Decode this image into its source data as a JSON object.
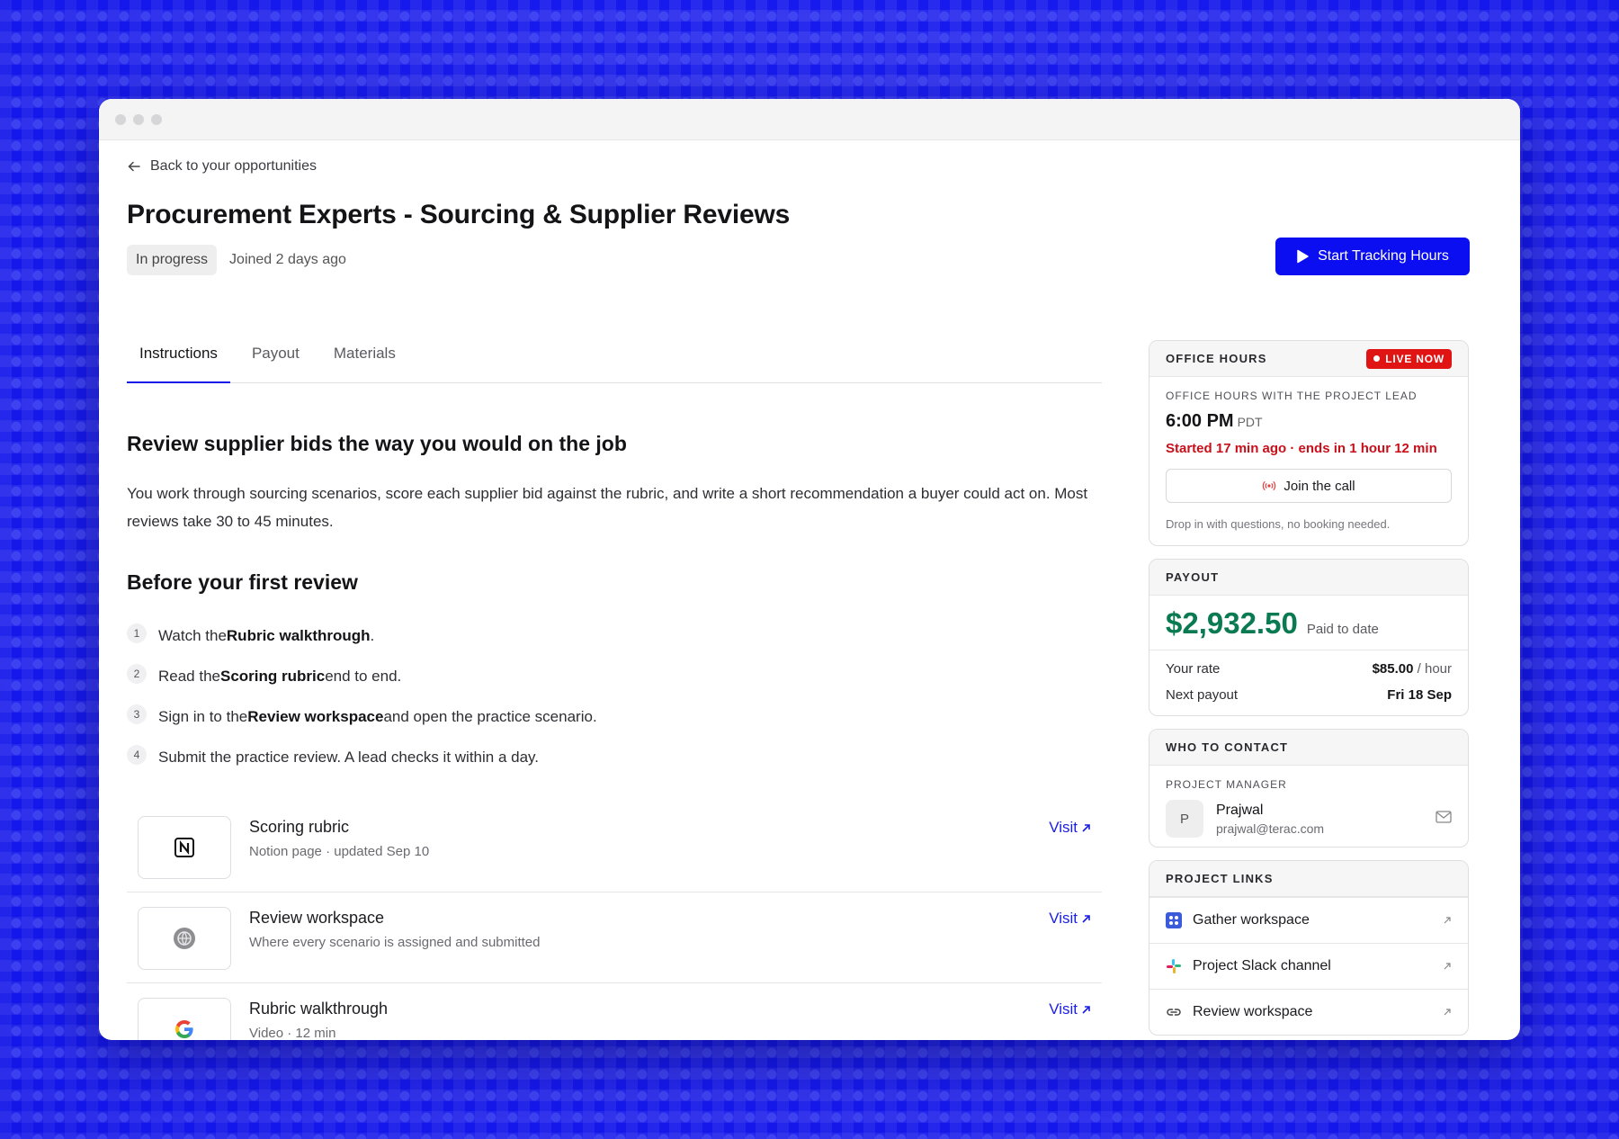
{
  "window": {
    "title": ""
  },
  "nav": {
    "back_label": "Back to your opportunities"
  },
  "header": {
    "title": "Procurement Experts - Sourcing & Supplier Reviews",
    "status": "In progress",
    "joined": "Joined 2 days ago",
    "cta_label": "Start Tracking Hours"
  },
  "tabs": [
    {
      "label": "Instructions",
      "active": true
    },
    {
      "label": "Payout",
      "active": false
    },
    {
      "label": "Materials",
      "active": false
    }
  ],
  "instructions": {
    "heading": "Review supplier bids the way you would on the job",
    "body": "You work through sourcing scenarios, score each supplier bid against the rubric, and write a short recommendation a buyer could act on. Most reviews take 30 to 45 minutes.",
    "steps_heading": "Before your first review",
    "steps": [
      {
        "num": "1",
        "pre": "Watch the ",
        "bold": "Rubric walkthrough",
        "post": "."
      },
      {
        "num": "2",
        "pre": "Read the ",
        "bold": "Scoring rubric",
        "post": " end to end."
      },
      {
        "num": "3",
        "pre": "Sign in to the ",
        "bold": "Review workspace",
        "post": " and open the practice scenario."
      },
      {
        "num": "4",
        "pre": "Submit the practice review. A lead checks it within a day.",
        "bold": "",
        "post": ""
      }
    ]
  },
  "resources": [
    {
      "title": "Scoring rubric",
      "subtitle": "Notion page · updated Sep 10",
      "action": "Visit",
      "icon": "notion-icon"
    },
    {
      "title": "Review workspace",
      "subtitle": "Where every scenario is assigned and submitted",
      "action": "Visit",
      "icon": "globe-icon"
    },
    {
      "title": "Rubric walkthrough",
      "subtitle": "Video · 12 min",
      "action": "Visit",
      "icon": "google-icon"
    }
  ],
  "office_hours": {
    "header": "OFFICE HOURS",
    "live_badge": "LIVE NOW",
    "subheader": "OFFICE HOURS WITH THE PROJECT LEAD",
    "time": "6:00 PM",
    "tz": "PDT",
    "status": "Started 17 min ago · ends in 1 hour 12 min",
    "join_label": "Join the call",
    "note": "Drop in with questions, no booking needed.",
    "status_color": "#c8101a"
  },
  "payout": {
    "header": "PAYOUT",
    "amount": "$2,932.50",
    "amount_label": "Paid to date",
    "rate_label": "Your rate",
    "rate_value": "$85.00",
    "rate_unit": "/ hour",
    "next_label": "Next payout",
    "next_value": "Fri 18 Sep",
    "amount_color": "#0a7a52"
  },
  "contact": {
    "header": "WHO TO CONTACT",
    "role": "PROJECT MANAGER",
    "initial": "P",
    "name": "Prajwal",
    "email": "prajwal@terac.com"
  },
  "links": {
    "header": "PROJECT LINKS",
    "items": [
      {
        "label": "Gather workspace",
        "icon": "gather-icon"
      },
      {
        "label": "Project Slack channel",
        "icon": "slack-icon"
      },
      {
        "label": "Review workspace",
        "icon": "link-icon"
      }
    ]
  },
  "colors": {
    "accent": "#0a0ef0",
    "live": "#e11414",
    "background": "#1a1ef0"
  }
}
